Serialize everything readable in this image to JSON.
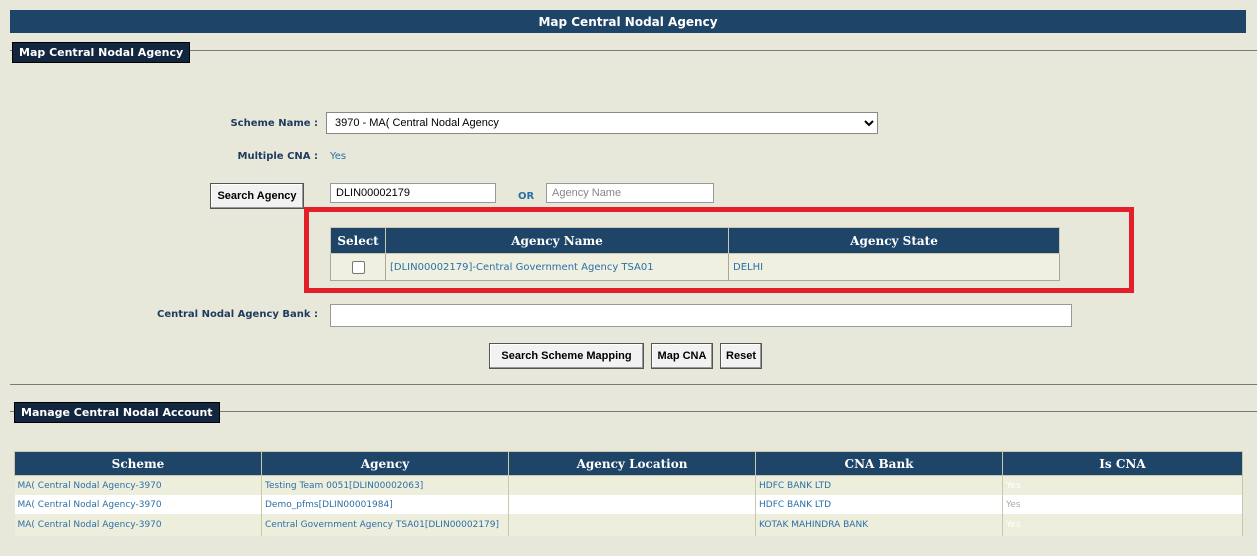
{
  "page": {
    "title": "Map Central Nodal Agency"
  },
  "map_section": {
    "legend": "Map Central Nodal Agency",
    "scheme_label": "Scheme Name :",
    "scheme_value": "3970 - MA( Central Nodal Agency",
    "multiple_cna_label": "Multiple CNA :",
    "multiple_cna_value": "Yes",
    "search_agency_button": "Search Agency",
    "agency_code_value": "DLIN00002179",
    "or_label": "OR",
    "agency_name_placeholder": "Agency Name",
    "agency_table": {
      "headers": {
        "select": "Select",
        "name": "Agency Name",
        "state": "Agency State"
      },
      "rows": [
        {
          "name": "[DLIN00002179]-Central Government Agency TSA01",
          "state": "DELHI"
        }
      ]
    },
    "bank_label": "Central Nodal Agency Bank :",
    "bank_value": "",
    "buttons": {
      "search_mapping": "Search Scheme Mapping",
      "map_cna": "Map CNA",
      "reset": "Reset"
    }
  },
  "manage_section": {
    "legend": "Manage Central Nodal Account",
    "headers": {
      "scheme": "Scheme",
      "agency": "Agency",
      "location": "Agency Location",
      "bank": "CNA Bank",
      "is_cna": "Is CNA"
    },
    "rows": [
      {
        "scheme": "MA( Central Nodal Agency-3970",
        "agency": "Testing Team 0051[DLIN00002063]",
        "location": "",
        "bank": "HDFC BANK LTD",
        "is_cna": "Yes"
      },
      {
        "scheme": "MA( Central Nodal Agency-3970",
        "agency": "Demo_pfms[DLIN00001984]",
        "location": "",
        "bank": "HDFC BANK LTD",
        "is_cna": "Yes"
      },
      {
        "scheme": "MA( Central Nodal Agency-3970",
        "agency": "Central Government Agency TSA01[DLIN00002179]",
        "location": "",
        "bank": "KOTAK MAHINDRA BANK",
        "is_cna": "Yes"
      }
    ]
  },
  "colors": {
    "header_bg": "#1e4468",
    "highlight": "#e32029",
    "page_bg": "#e8e8da"
  }
}
